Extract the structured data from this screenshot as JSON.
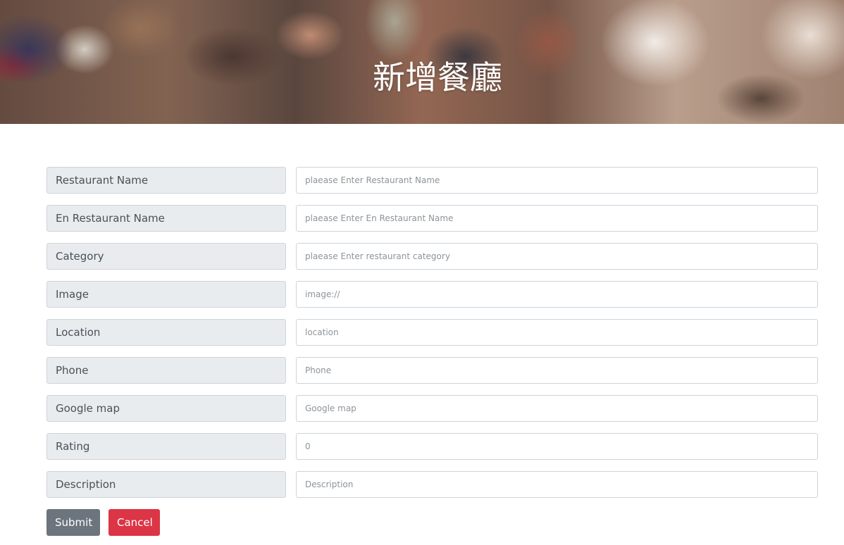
{
  "banner": {
    "title": "新增餐廳"
  },
  "form": {
    "fields": [
      {
        "label": "Restaurant Name",
        "placeholder": "plaease Enter Restaurant Name"
      },
      {
        "label": "En Restaurant Name",
        "placeholder": "plaease Enter En Restaurant Name"
      },
      {
        "label": "Category",
        "placeholder": "plaease Enter restaurant category"
      },
      {
        "label": "Image",
        "placeholder": "image://"
      },
      {
        "label": "Location",
        "placeholder": "location"
      },
      {
        "label": "Phone",
        "placeholder": "Phone"
      },
      {
        "label": "Google map",
        "placeholder": "Google map"
      },
      {
        "label": "Rating",
        "placeholder": "0"
      },
      {
        "label": "Description",
        "placeholder": "Description"
      }
    ]
  },
  "actions": {
    "submit_label": "Submit",
    "cancel_label": "Cancel"
  },
  "colors": {
    "submit": "#6c757d",
    "cancel": "#dc3545",
    "label_bg": "#e9ecef"
  }
}
